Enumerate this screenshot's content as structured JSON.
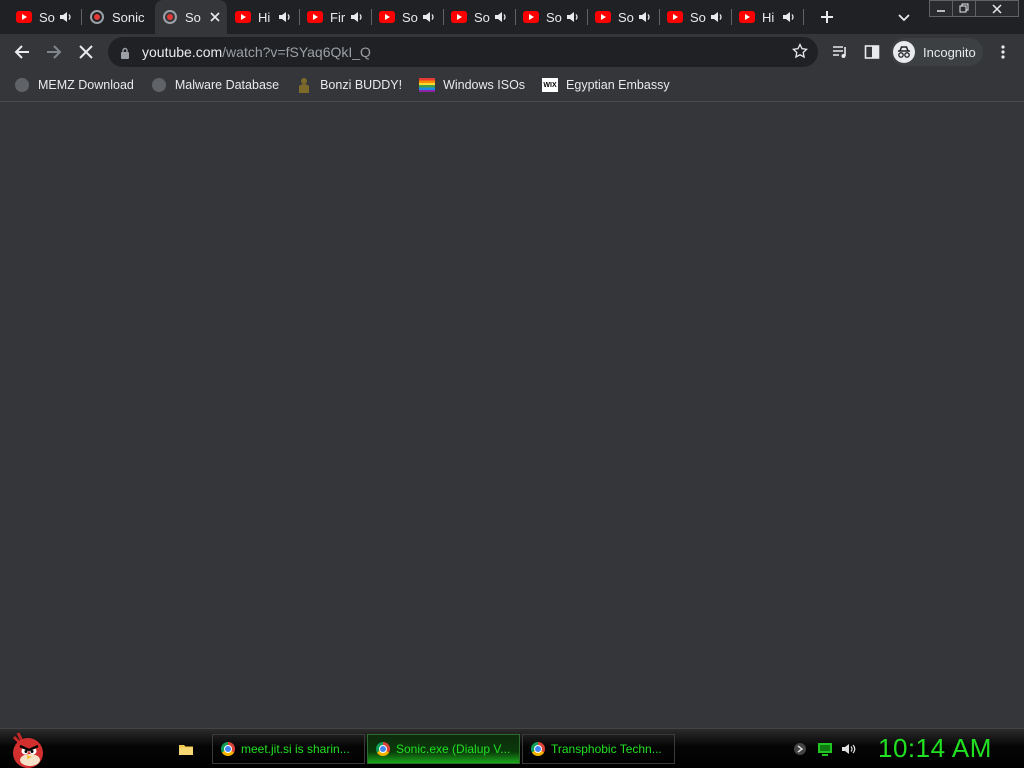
{
  "browser": {
    "tabs": [
      {
        "label": "So",
        "favicon": "youtube-icon",
        "audio": true,
        "active": false
      },
      {
        "label": "Sonic.",
        "favicon": "recording-icon",
        "audio": false,
        "active": false
      },
      {
        "label": "So",
        "favicon": "recording-icon",
        "audio": false,
        "active": true
      },
      {
        "label": "Hi",
        "favicon": "youtube-icon",
        "audio": true,
        "active": false
      },
      {
        "label": "Fir",
        "favicon": "youtube-icon",
        "audio": true,
        "active": false
      },
      {
        "label": "So",
        "favicon": "youtube-icon",
        "audio": true,
        "active": false
      },
      {
        "label": "So",
        "favicon": "youtube-icon",
        "audio": true,
        "active": false
      },
      {
        "label": "So",
        "favicon": "youtube-icon",
        "audio": true,
        "active": false
      },
      {
        "label": "So",
        "favicon": "youtube-icon",
        "audio": true,
        "active": false
      },
      {
        "label": "So",
        "favicon": "youtube-icon",
        "audio": true,
        "active": false
      },
      {
        "label": "Hi",
        "favicon": "youtube-icon",
        "audio": true,
        "active": false
      }
    ],
    "address": {
      "host": "youtube.com",
      "path": "/watch?v=fSYaq6QkI_Q"
    },
    "profile_label": "Incognito",
    "bookmarks": [
      {
        "label": "MEMZ Download",
        "icon": "globe-icon"
      },
      {
        "label": "Malware Database",
        "icon": "globe-icon"
      },
      {
        "label": "Bonzi BUDDY!",
        "icon": "bonzi-icon"
      },
      {
        "label": "Windows ISOs",
        "icon": "rainbow-flag-icon"
      },
      {
        "label": "Egyptian Embassy",
        "icon": "wix-icon"
      }
    ],
    "wix_text": "WIX"
  },
  "taskbar": {
    "tasks": [
      {
        "label": "meet.jit.si is sharin...",
        "active": false
      },
      {
        "label": "Sonic.exe (Dialup V...",
        "active": true
      },
      {
        "label": "Transphobic Techn...",
        "active": false
      }
    ],
    "clock": "10:14 AM"
  },
  "colors": {
    "accent_green": "#21e021",
    "youtube_red": "#ff0000",
    "chrome_frame": "#202124",
    "chrome_toolbar": "#35363a"
  }
}
